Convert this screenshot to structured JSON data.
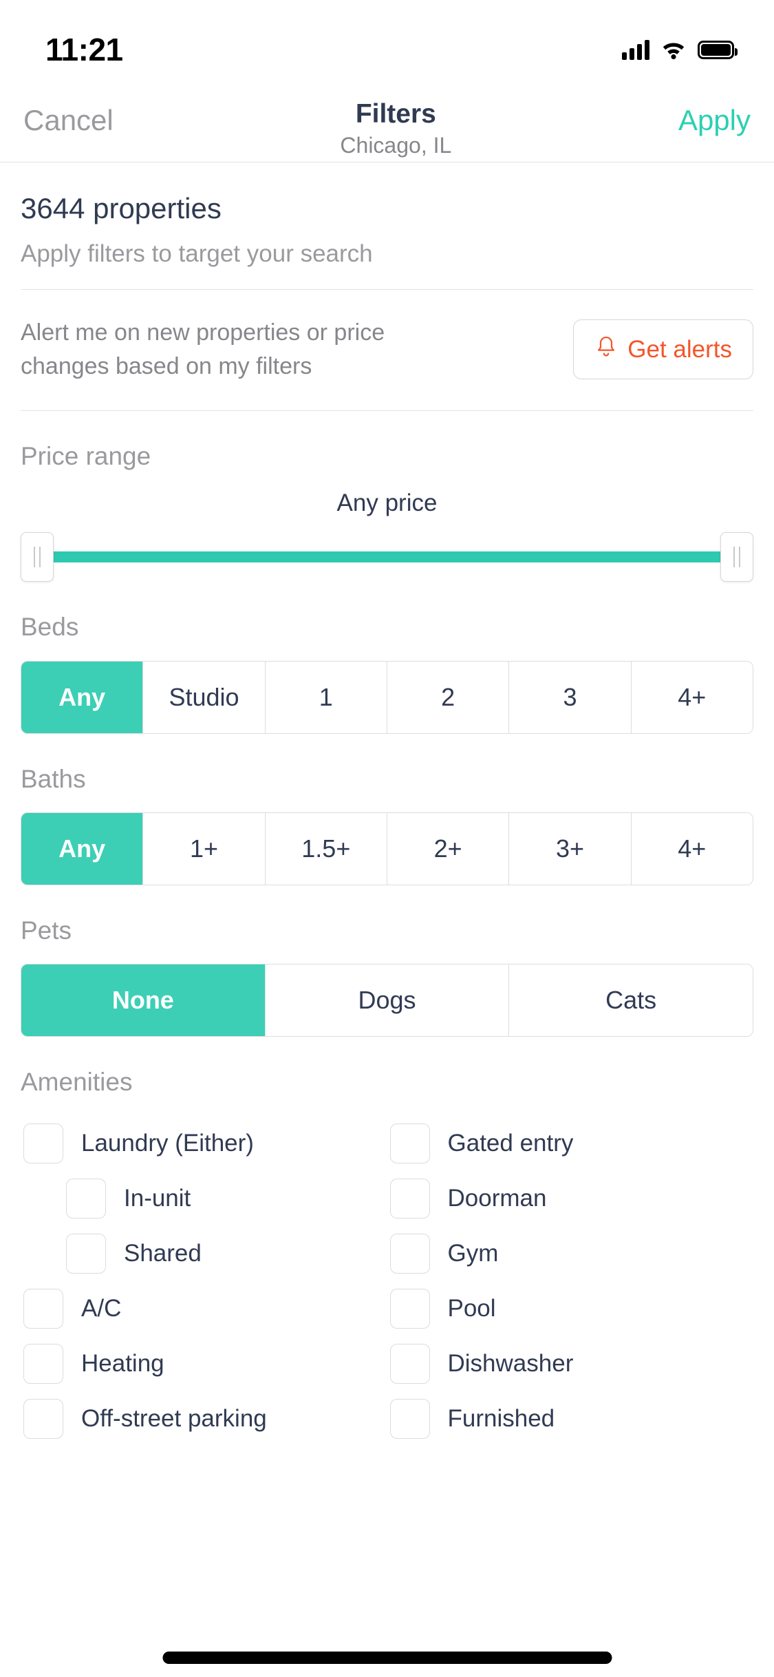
{
  "status_bar": {
    "time": "11:21",
    "icons": [
      "cellular-signal-icon",
      "wifi-icon",
      "battery-icon"
    ]
  },
  "header": {
    "cancel_label": "Cancel",
    "title": "Filters",
    "subtitle": "Chicago, IL",
    "apply_label": "Apply"
  },
  "results": {
    "count_label": "3644 properties",
    "hint": "Apply filters to target your search"
  },
  "alerts": {
    "description": "Alert me on new properties or price changes based on my filters",
    "button_label": "Get alerts",
    "button_icon": "bell-icon"
  },
  "price_range": {
    "label": "Price range",
    "value": "Any price",
    "fill_percent": 100
  },
  "beds": {
    "label": "Beds",
    "selected": "Any",
    "options": [
      "Any",
      "Studio",
      "1",
      "2",
      "3",
      "4+"
    ]
  },
  "baths": {
    "label": "Baths",
    "selected": "Any",
    "options": [
      "Any",
      "1+",
      "1.5+",
      "2+",
      "3+",
      "4+"
    ]
  },
  "pets": {
    "label": "Pets",
    "selected": "None",
    "options": [
      "None",
      "Dogs",
      "Cats"
    ]
  },
  "amenities": {
    "label": "Amenities",
    "left_column": [
      {
        "label": "Laundry (Either)",
        "checked": false,
        "indent": false
      },
      {
        "label": "In-unit",
        "checked": false,
        "indent": true
      },
      {
        "label": "Shared",
        "checked": false,
        "indent": true
      },
      {
        "label": "A/C",
        "checked": false,
        "indent": false
      },
      {
        "label": "Heating",
        "checked": false,
        "indent": false
      },
      {
        "label": "Off-street parking",
        "checked": false,
        "indent": false
      }
    ],
    "right_column": [
      {
        "label": "Gated entry",
        "checked": false,
        "indent": false
      },
      {
        "label": "Doorman",
        "checked": false,
        "indent": false
      },
      {
        "label": "Gym",
        "checked": false,
        "indent": false
      },
      {
        "label": "Pool",
        "checked": false,
        "indent": false
      },
      {
        "label": "Dishwasher",
        "checked": false,
        "indent": false
      },
      {
        "label": "Furnished",
        "checked": false,
        "indent": false
      }
    ]
  },
  "colors": {
    "accent_teal": "#3ccfb5",
    "apply_teal": "#2ad0b2",
    "alert_orange": "#f4552a",
    "text_dark": "#303a52",
    "text_muted": "#9a9a9e"
  }
}
